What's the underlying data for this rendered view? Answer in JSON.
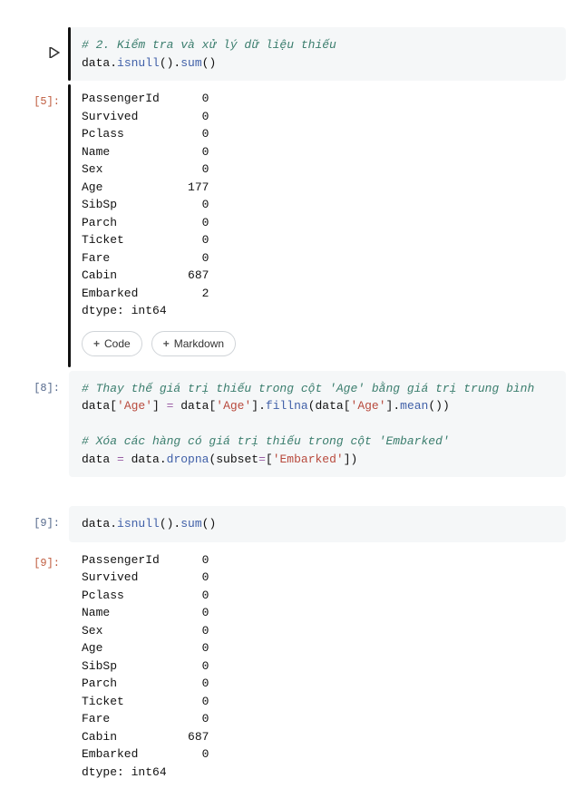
{
  "cells": {
    "c1": {
      "comment": "# 2. Kiểm tra và xử lý dữ liệu thiếu",
      "code_prefix": "data.",
      "call1": "isnull",
      "mid": "().",
      "call2": "sum",
      "tail": "()"
    },
    "out1": {
      "prompt": "[5]:",
      "text": "PassengerId      0\nSurvived         0\nPclass           0\nName             0\nSex              0\nAge            177\nSibSp            0\nParch            0\nTicket           0\nFare             0\nCabin          687\nEmbarked         2\ndtype: int64"
    },
    "buttons": {
      "code": "Code",
      "markdown": "Markdown"
    },
    "c2": {
      "prompt": "[8]:",
      "comment1": "# Thay thế giá trị thiếu trong cột 'Age' bằng giá trị trung bình",
      "l2_a": "data[",
      "l2_s1": "'Age'",
      "l2_b": "] ",
      "l2_op": "=",
      "l2_c": " data[",
      "l2_s2": "'Age'",
      "l2_d": "].",
      "l2_call1": "fillna",
      "l2_e": "(data[",
      "l2_s3": "'Age'",
      "l2_f": "].",
      "l2_call2": "mean",
      "l2_g": "())",
      "comment2": "# Xóa các hàng có giá trị thiếu trong cột 'Embarked'",
      "l4_a": "data ",
      "l4_op": "=",
      "l4_b": " data.",
      "l4_call": "dropna",
      "l4_c": "(subset",
      "l4_op2": "=",
      "l4_d": "[",
      "l4_s": "'Embarked'",
      "l4_e": "])"
    },
    "c3": {
      "prompt": "[9]:",
      "a": "data.",
      "call1": "isnull",
      "b": "().",
      "call2": "sum",
      "c": "()"
    },
    "out2": {
      "prompt": "[9]:",
      "text": "PassengerId      0\nSurvived         0\nPclass           0\nName             0\nSex              0\nAge              0\nSibSp            0\nParch            0\nTicket           0\nFare             0\nCabin          687\nEmbarked         0\ndtype: int64"
    }
  }
}
